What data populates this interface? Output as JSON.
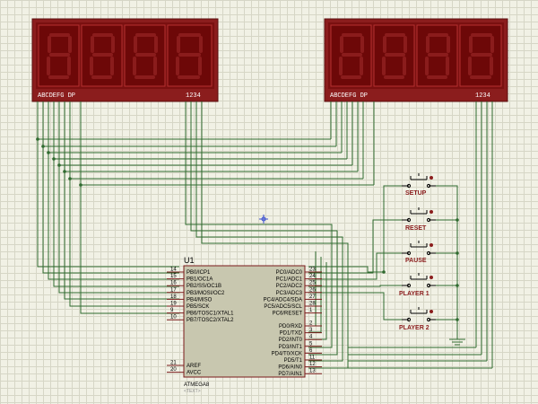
{
  "display_left": {
    "segment_label": "ABCDEFG  DP",
    "digit_label": "1234"
  },
  "display_right": {
    "segment_label": "ABCDEFG  DP",
    "digit_label": "1234"
  },
  "chip": {
    "reference": "U1",
    "part": "ATMEGA8",
    "text_placeholder": "<TEXT>",
    "left_pins": [
      {
        "num": "14",
        "name": "PB0/ICP1"
      },
      {
        "num": "15",
        "name": "PB1/OC1A"
      },
      {
        "num": "16",
        "name": "PB2/SS/OC1B"
      },
      {
        "num": "17",
        "name": "PB3/MOSI/OC2"
      },
      {
        "num": "18",
        "name": "PB4/MISO"
      },
      {
        "num": "19",
        "name": "PB5/SCK"
      },
      {
        "num": "9",
        "name": "PB6/TOSC1/XTAL1"
      },
      {
        "num": "10",
        "name": "PB7/TOSC2/XTAL2"
      }
    ],
    "left_bottom_pins": [
      {
        "num": "21",
        "name": "AREF"
      },
      {
        "num": "20",
        "name": "AVCC"
      }
    ],
    "right_pins": [
      {
        "num": "23",
        "name": "PC0/ADC0"
      },
      {
        "num": "24",
        "name": "PC1/ADC1"
      },
      {
        "num": "25",
        "name": "PC2/ADC2"
      },
      {
        "num": "26",
        "name": "PC3/ADC3"
      },
      {
        "num": "27",
        "name": "PC4/ADC4/SDA"
      },
      {
        "num": "28",
        "name": "PC5/ADC5/SCL"
      },
      {
        "num": "1",
        "name": "PC6/RESET"
      }
    ],
    "right_bottom_pins": [
      {
        "num": "2",
        "name": "PD0/RXD"
      },
      {
        "num": "3",
        "name": "PD1/TXD"
      },
      {
        "num": "4",
        "name": "PD2/INT0"
      },
      {
        "num": "5",
        "name": "PD3/INT1"
      },
      {
        "num": "6",
        "name": "PD4/T0/XCK"
      },
      {
        "num": "11",
        "name": "PD5/T1"
      },
      {
        "num": "12",
        "name": "PD6/AIN0"
      },
      {
        "num": "13",
        "name": "PD7/AIN1"
      }
    ]
  },
  "buttons": [
    {
      "label": "SETUP"
    },
    {
      "label": "RESET"
    },
    {
      "label": "PAUSE"
    },
    {
      "label": "PLAYER 1"
    },
    {
      "label": "PLAYER 2"
    }
  ],
  "colors": {
    "wire": "#2f6a2f",
    "display_body": "#8b1d1d",
    "chip_body": "#c8c7af",
    "grid_background": "#f1f1e5"
  }
}
